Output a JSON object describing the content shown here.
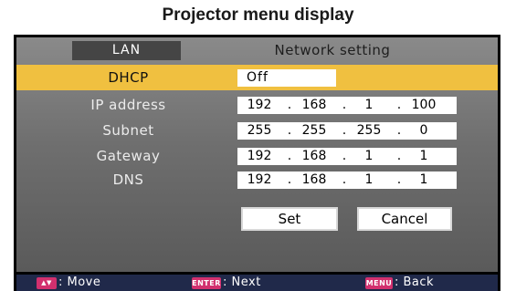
{
  "page_title": "Projector menu display",
  "header": {
    "tab_label": "LAN",
    "title": "Network setting"
  },
  "rows": [
    {
      "label": "DHCP",
      "value": "Off",
      "selected": true
    },
    {
      "label": "IP address",
      "octets": [
        "192",
        "168",
        "1",
        "100"
      ]
    },
    {
      "label": "Subnet",
      "octets": [
        "255",
        "255",
        "255",
        "0"
      ]
    },
    {
      "label": "Gateway",
      "octets": [
        "192",
        "168",
        "1",
        "1"
      ]
    },
    {
      "label": "DNS",
      "octets": [
        "192",
        "168",
        "1",
        "1"
      ]
    }
  ],
  "buttons": {
    "set": "Set",
    "cancel": "Cancel"
  },
  "footer": {
    "move_key": "▲▼",
    "move_label": ": Move",
    "enter_key": "ENTER",
    "next_label": ": Next",
    "menu_key": "MENU",
    "back_label": ": Back"
  },
  "colors": {
    "highlight": "#f0c040",
    "footer_bg": "#20294a",
    "key_badge": "#d2306e"
  }
}
